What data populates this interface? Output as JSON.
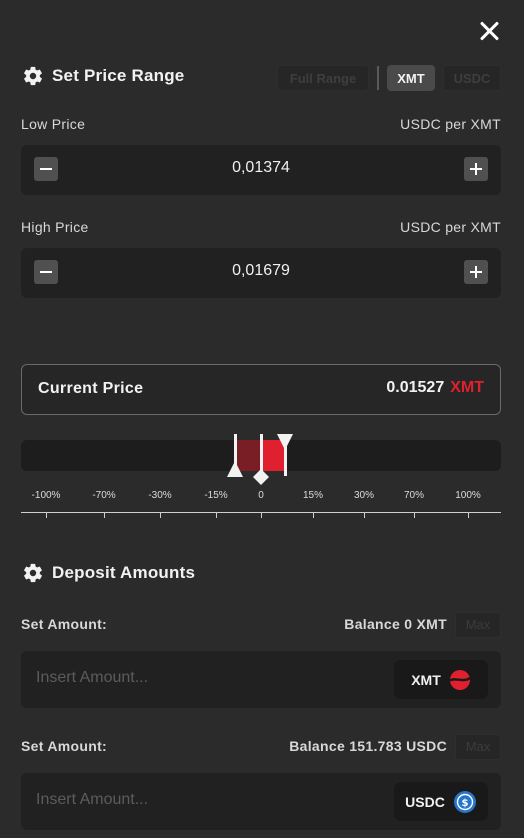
{
  "price_range": {
    "title": "Set Price Range",
    "toggle": {
      "full_range": "Full Range",
      "token_a": "XMT",
      "token_b": "USDC",
      "selected": "XMT"
    },
    "low": {
      "label": "Low Price",
      "unit": "USDC per XMT",
      "value": "0,01374"
    },
    "high": {
      "label": "High Price",
      "unit": "USDC per XMT",
      "value": "0,01679"
    }
  },
  "current_price": {
    "label": "Current Price",
    "value": "0.01527",
    "token": "XMT"
  },
  "range_slider": {
    "tick_labels": [
      "-100%",
      "-70%",
      "-30%",
      "-15%",
      "0",
      "15%",
      "30%",
      "70%",
      "100%"
    ],
    "colors": {
      "below_current": "#7a1e26",
      "above_current": "#e0202e",
      "track": "#1d1d1d"
    }
  },
  "deposit": {
    "title": "Deposit Amounts",
    "rows": [
      {
        "label": "Set Amount:",
        "balance": "Balance 0 XMT",
        "max": "Max",
        "placeholder": "Insert Amount...",
        "token": "XMT",
        "icon": "xmt-token-icon"
      },
      {
        "label": "Set Amount:",
        "balance": "Balance 151.783 USDC",
        "max": "Max",
        "placeholder": "Insert Amount...",
        "token": "USDC",
        "icon": "usdc-token-icon"
      }
    ]
  },
  "colors": {
    "background": "#2b2b2b",
    "panel": "#212121",
    "accent_red": "#e0202e",
    "usdc_blue": "#2775ca"
  }
}
